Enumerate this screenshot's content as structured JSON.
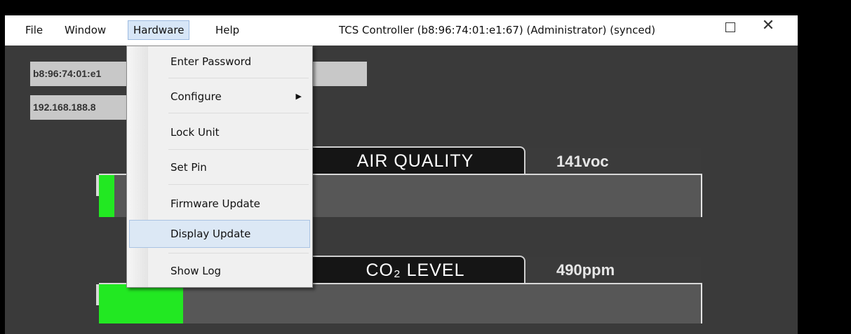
{
  "window": {
    "title": "TCS Controller (b8:96:74:01:e1:67) (Administrator) (synced)"
  },
  "menubar": {
    "file": "File",
    "window": "Window",
    "hardware": "Hardware",
    "help": "Help"
  },
  "fields": {
    "mac": "b8:96:74:01:e1",
    "ip": "192.168.188.8"
  },
  "gauges": [
    {
      "label": "AIR QUALITY",
      "reading": "141voc",
      "level": 0.0
    },
    {
      "label": "CO₂ LEVEL",
      "reading": "490ppm",
      "level": 0.14
    }
  ],
  "hardware_menu": {
    "items": [
      {
        "label": "Enter Password"
      },
      {
        "label": "Configure",
        "submenu": true
      },
      {
        "label": "Lock Unit"
      },
      {
        "label": "Set Pin"
      },
      {
        "label": "Firmware Update"
      },
      {
        "label": "Display Update",
        "highlighted": true
      },
      {
        "label": "Show Log"
      }
    ]
  },
  "icons": {
    "restore": "restore-window-icon",
    "close": "close-icon",
    "submenu": "chevron-right-icon"
  },
  "colors": {
    "gauge_fill": "#22e822",
    "tab_background": "#151515",
    "menu_highlight": "#dce8f5"
  }
}
